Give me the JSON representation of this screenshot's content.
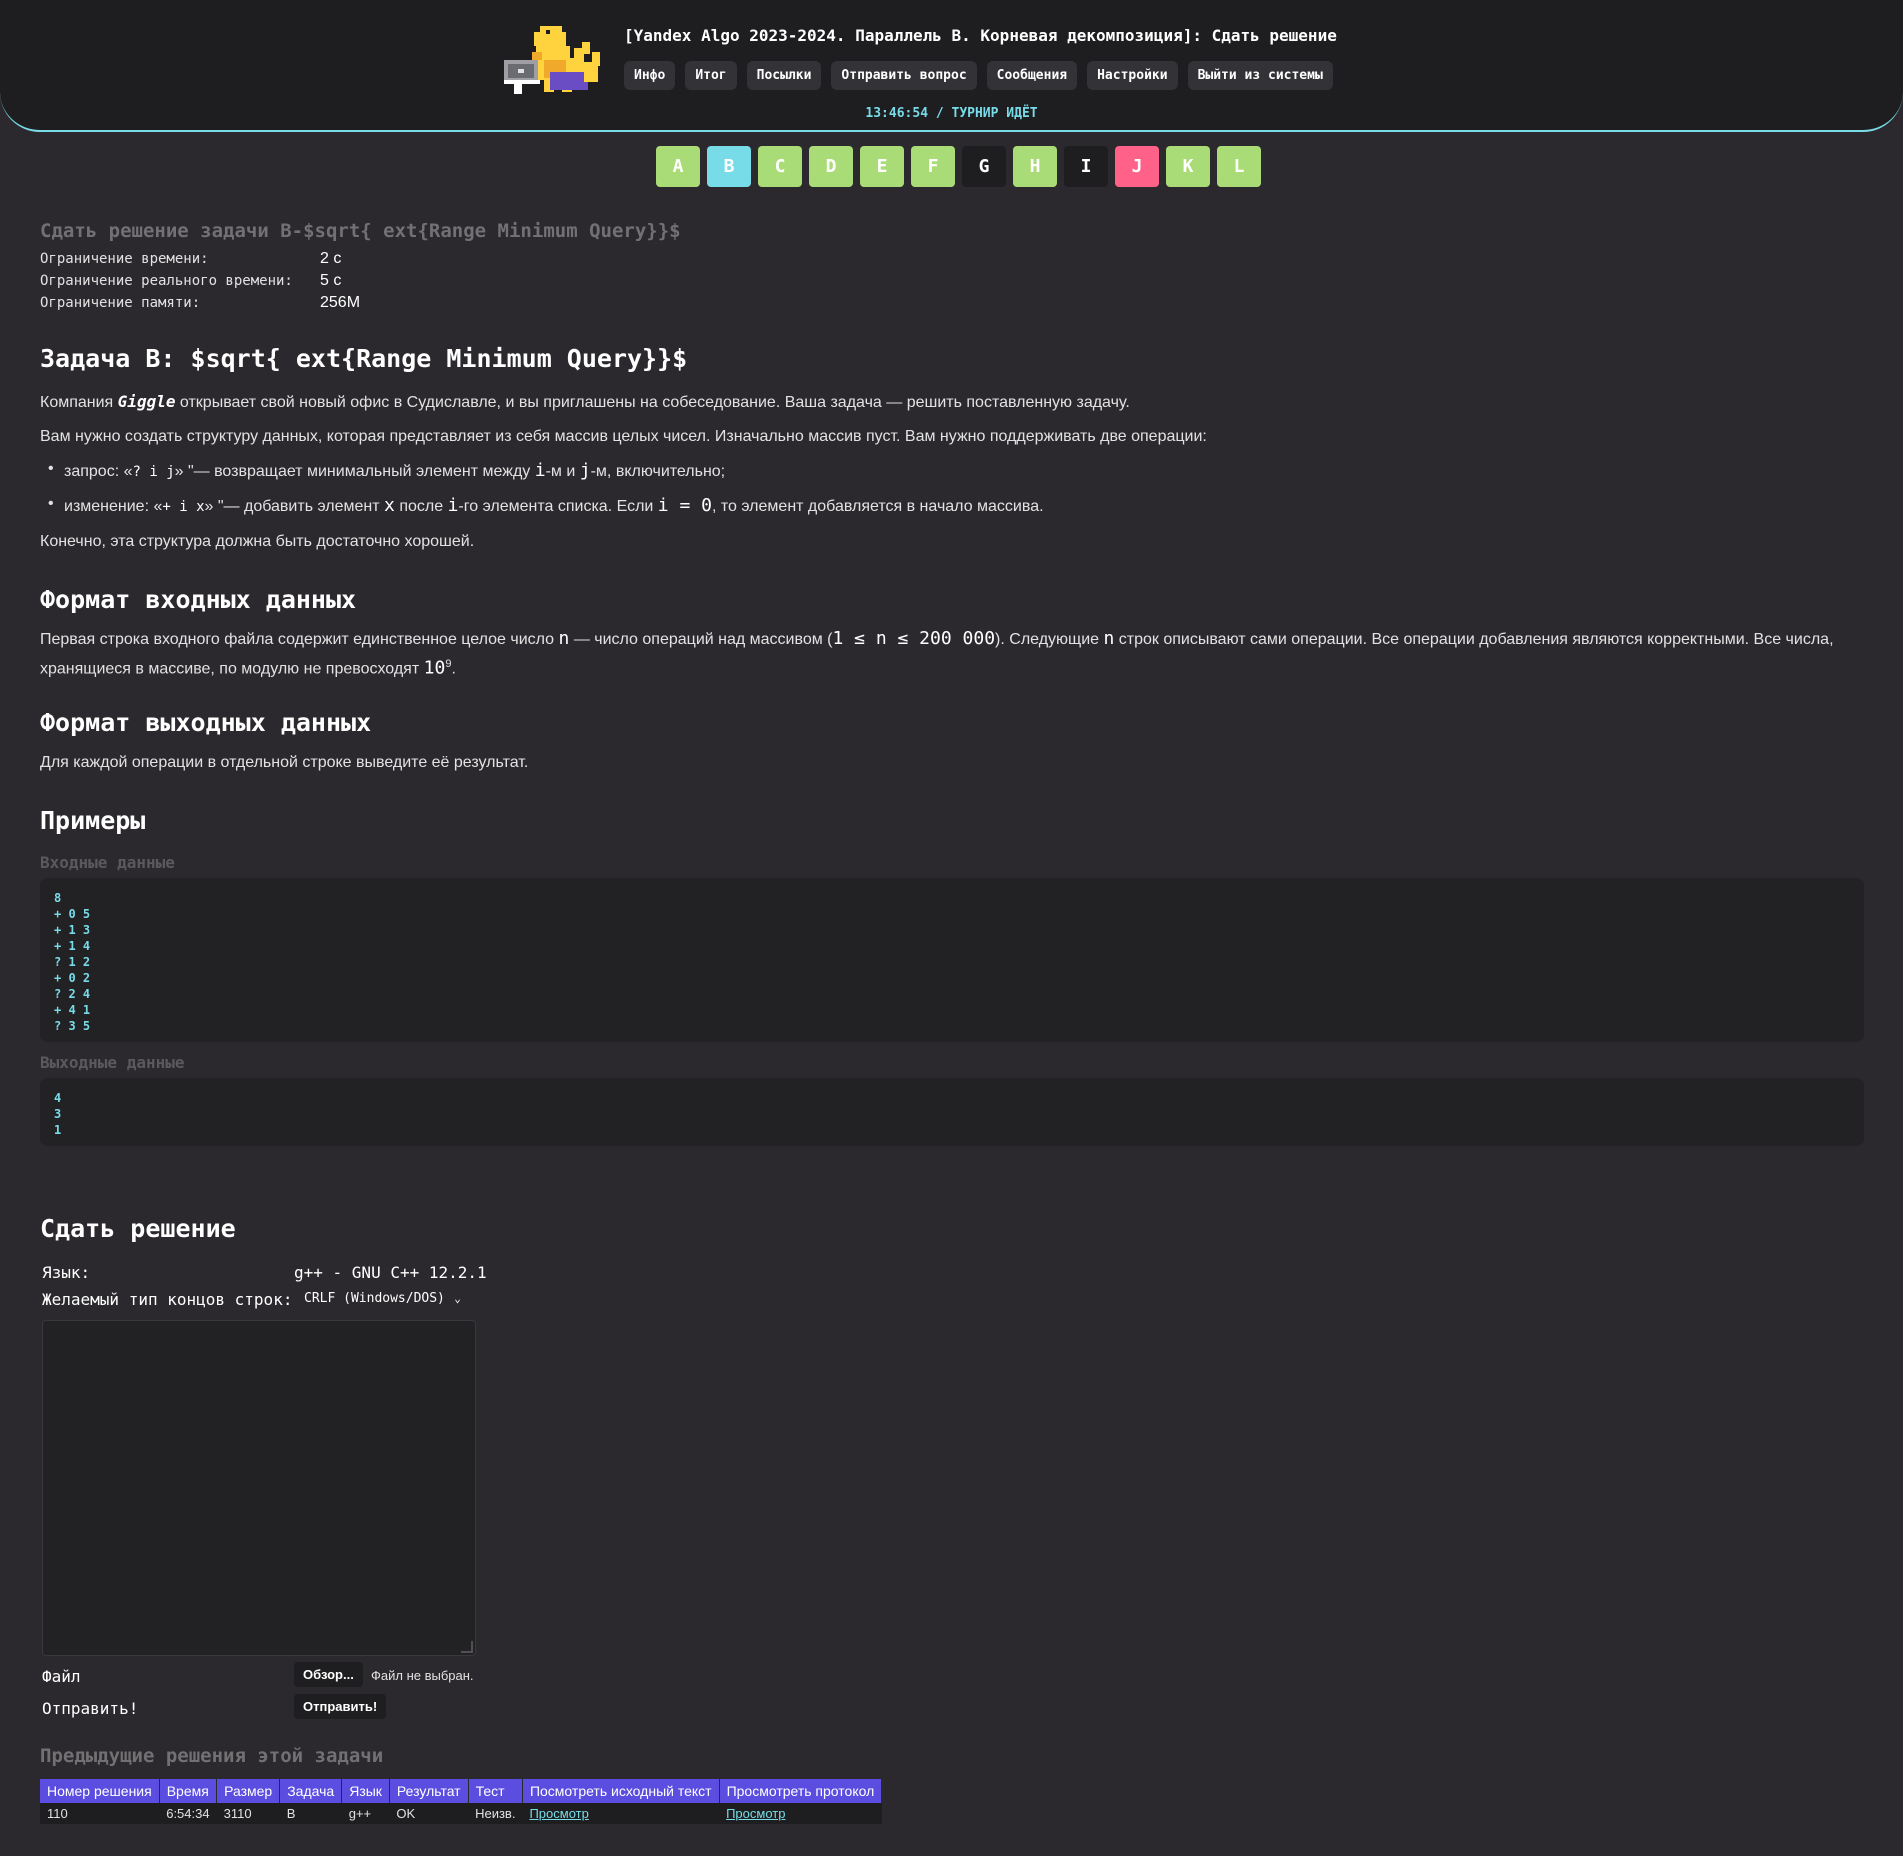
{
  "header": {
    "title": "[Yandex Algo 2023-2024. Параллель B. Корневая декомпозиция]: Сдать решение",
    "nav": [
      "Инфо",
      "Итог",
      "Посылки",
      "Отправить вопрос",
      "Сообщения",
      "Настройки",
      "Выйти из системы"
    ],
    "status": "13:46:54 / ТУРНИР ИДЁТ"
  },
  "tabs": [
    {
      "label": "A",
      "color": "#a9dc76"
    },
    {
      "label": "B",
      "color": "#78dce8"
    },
    {
      "label": "C",
      "color": "#a9dc76"
    },
    {
      "label": "D",
      "color": "#a9dc76"
    },
    {
      "label": "E",
      "color": "#a9dc76"
    },
    {
      "label": "F",
      "color": "#a9dc76"
    },
    {
      "label": "G",
      "color": "#1e1e20"
    },
    {
      "label": "H",
      "color": "#a9dc76"
    },
    {
      "label": "I",
      "color": "#1e1e20"
    },
    {
      "label": "J",
      "color": "#ff6188"
    },
    {
      "label": "K",
      "color": "#a9dc76"
    },
    {
      "label": "L",
      "color": "#a9dc76"
    }
  ],
  "problem": {
    "submit_heading": "Сдать решение задачи B-$sqrt{ ext{Range Minimum Query}}$",
    "limits": [
      {
        "label": "Ограничение времени:",
        "value": "2 с"
      },
      {
        "label": "Ограничение реального времени:",
        "value": "5 с"
      },
      {
        "label": "Ограничение памяти:",
        "value": "256M"
      }
    ],
    "title": "Задача B: $sqrt{ ext{Range Minimum Query}}$",
    "p1_a": "Компания ",
    "p1_company": "Giggle",
    "p1_b": " открывает свой новый офис в Судиславле, и вы приглашены на собеседование. Ваша задача — решить поставленную задачу.",
    "p2": "Вам нужно создать структуру данных, которая представляет из себя массив целых чисел. Изначально массив пуст. Вам нужно поддерживать две операции:",
    "b1_a": "запрос: «",
    "b1_code": "? i j",
    "b1_b": "» \"— возвращает минимальный элемент между ",
    "b1_i": "i",
    "b1_c": "-м и ",
    "b1_j": "j",
    "b1_d": "-м, включительно;",
    "b2_a": "изменение: «",
    "b2_code": "+ i x",
    "b2_b": "» \"— добавить элемент ",
    "b2_x": "x",
    "b2_c": " после ",
    "b2_i": "i",
    "b2_d": "-го элемента списка. Если ",
    "b2_eq": "i = 0",
    "b2_e": ", то элемент добавляется в начало массива.",
    "p3": "Конечно, эта структура должна быть достаточно хорошей.",
    "input_heading": "Формат входных данных",
    "input_a": "Первая строка входного файла содержит единственное целое число ",
    "input_n1": "n",
    "input_b": " — число операций над массивом (",
    "input_range": "1 ≤ n ≤ 200 000",
    "input_c": "). Следующие ",
    "input_n2": "n",
    "input_d": " строк описывают сами операции. Все операции добавления являются корректными. Все числа, хранящиеся в массиве, по модулю не превосходят ",
    "input_pow_base": "10",
    "input_pow_exp": "9",
    "input_e": ".",
    "output_heading": "Формат выходных данных",
    "output_text": "Для каждой операции в отдельной строке выведите её результат.",
    "examples_heading": "Примеры",
    "input_label": "Входные данные",
    "input_sample": "8\n+ 0 5\n+ 1 3\n+ 1 4\n? 1 2\n+ 0 2\n? 2 4\n+ 4 1\n? 3 5",
    "output_label": "Выходные данные",
    "output_sample": "4\n3\n1"
  },
  "form": {
    "heading": "Сдать решение",
    "lang_label": "Язык:",
    "lang_value": "g++ - GNU C++ 12.2.1",
    "eol_label": "Желаемый тип концов строк:",
    "eol_value": "CRLF (Windows/DOS)",
    "file_label": "Файл",
    "browse_button": "Обзор...",
    "file_status": "Файл не выбран.",
    "submit_label": "Отправить!",
    "submit_button": "Отправить!"
  },
  "previous": {
    "heading": "Предыдущие решения этой задачи",
    "columns": [
      "Номер решения",
      "Время",
      "Размер",
      "Задача",
      "Язык",
      "Результат",
      "Тест",
      "Посмотреть исходный текст",
      "Просмотреть протокол"
    ],
    "rows": [
      [
        "110",
        "6:54:34",
        "3110",
        "B",
        "g++",
        "OK",
        "Неизв.",
        "Просмотр",
        "Просмотр"
      ]
    ]
  }
}
